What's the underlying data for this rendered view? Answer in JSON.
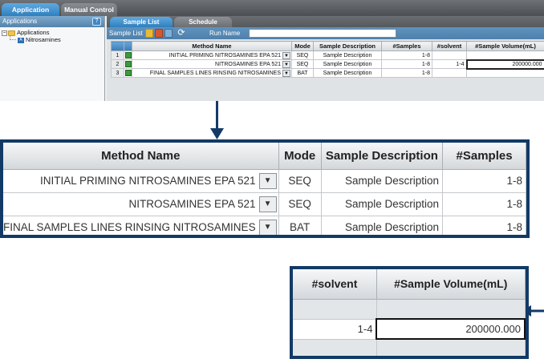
{
  "main_tabs": [
    "Application",
    "Manual Control"
  ],
  "left_panel": {
    "header": "Applications",
    "help_icon": "?",
    "tree": {
      "root": "Applications",
      "child": "Nitrosamines"
    }
  },
  "sub_tabs": [
    "Sample List",
    "Schedule"
  ],
  "toolbar": {
    "label": "Sample List",
    "run_name_label": "Run Name",
    "run_name_value": ""
  },
  "grid": {
    "columns": [
      "Method Name",
      "Mode",
      "Sample Description",
      "#Samples",
      "#solvent",
      "#Sample Volume(mL)"
    ],
    "rows": [
      {
        "num": "1",
        "method": "INITIAL PRIMING NITROSAMINES EPA 521",
        "mode": "SEQ",
        "desc": "Sample Description",
        "samples": "1-8",
        "solvent": "",
        "volume": ""
      },
      {
        "num": "2",
        "method": "NITROSAMINES EPA 521",
        "mode": "SEQ",
        "desc": "Sample Description",
        "samples": "1-8",
        "solvent": "1-4",
        "volume": "200000.000"
      },
      {
        "num": "3",
        "method": "FINAL SAMPLES LINES RINSING NITROSAMINES",
        "mode": "BAT",
        "desc": "Sample Description",
        "samples": "1-8",
        "solvent": "",
        "volume": ""
      }
    ]
  },
  "icons": {
    "dropdown": "chevron-down-icon",
    "row_status": "play-icon",
    "refresh": "refresh-icon"
  },
  "colors": {
    "callout": "#123a66",
    "tab_active": "#2f7fbe"
  }
}
